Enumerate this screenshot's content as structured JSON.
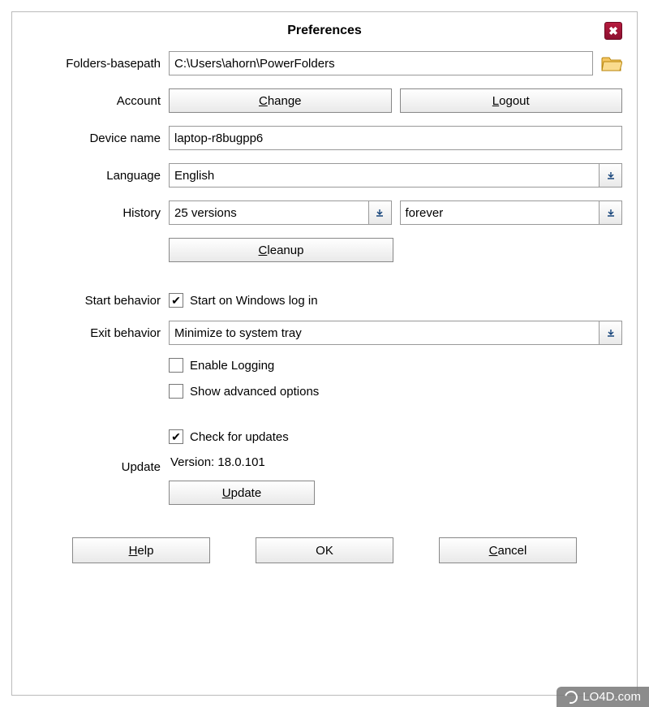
{
  "title": "Preferences",
  "close_glyph": "✖",
  "labels": {
    "basepath": "Folders-basepath",
    "account": "Account",
    "device": "Device name",
    "language": "Language",
    "history": "History",
    "start": "Start behavior",
    "exit": "Exit behavior",
    "update": "Update"
  },
  "basepath": {
    "value": "C:\\Users\\ahorn\\PowerFolders"
  },
  "account": {
    "change": "Change",
    "logout": "Logout"
  },
  "device": {
    "value": "laptop-r8bugpp6"
  },
  "language": {
    "value": "English"
  },
  "history": {
    "versions": "25 versions",
    "duration": "forever",
    "cleanup": "Cleanup"
  },
  "start": {
    "checkbox_label": "Start on Windows log in",
    "checked": true
  },
  "exit": {
    "value": "Minimize to system tray"
  },
  "logging": {
    "label": "Enable Logging",
    "checked": false
  },
  "advanced": {
    "label": "Show advanced options",
    "checked": false
  },
  "update": {
    "checkbox_label": "Check for updates",
    "checked": true,
    "version": "Version: 18.0.101",
    "button": "Update"
  },
  "buttons": {
    "help": "Help",
    "ok": "OK",
    "cancel": "Cancel"
  },
  "watermark": "LO4D.com"
}
